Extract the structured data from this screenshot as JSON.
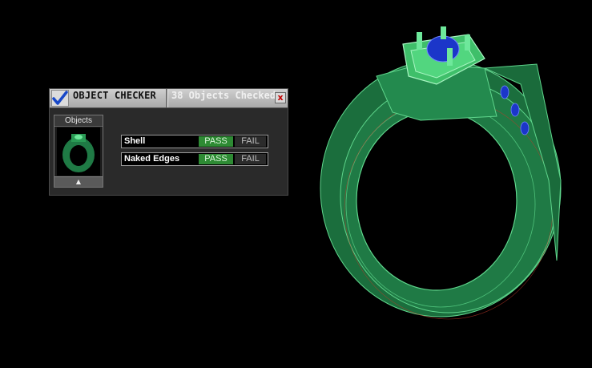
{
  "checker": {
    "title": "OBJECT CHECKER",
    "objects_checked": "38  Objects Checked",
    "close_label": "x",
    "objects_panel": {
      "header": "Objects",
      "scroll_up": "▲"
    },
    "checks": [
      {
        "label": "Shell",
        "pass": "PASS",
        "fail": "FAIL",
        "result": "pass"
      },
      {
        "label": "Naked Edges",
        "pass": "PASS",
        "fail": "FAIL",
        "result": "pass"
      }
    ]
  },
  "viewport": {
    "background": "#000000",
    "model_color": "#1f7a45",
    "wire_color": "#6ee89b",
    "gem_color": "#1b36c9"
  }
}
